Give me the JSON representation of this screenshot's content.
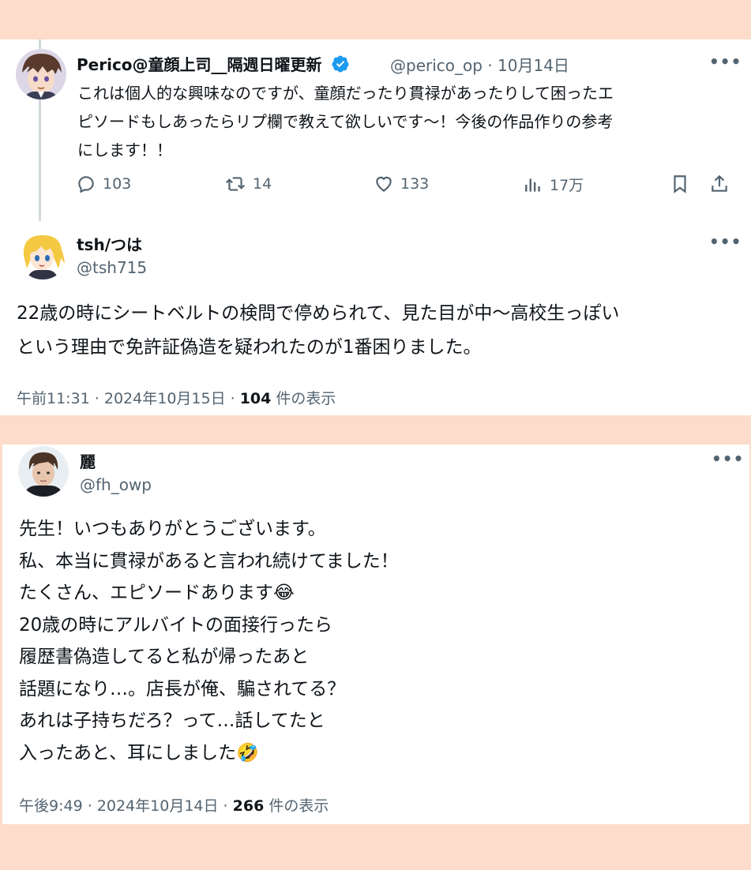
{
  "colors": {
    "background": "#fddccb",
    "card": "#ffffff",
    "text": "#0f1419",
    "muted": "#536471",
    "verified": "#1d9bf0"
  },
  "tweet1": {
    "display_name": "Perico@童顔上司__隔週日曜更新",
    "handle": "@perico_op",
    "separator": "·",
    "date": "10月14日",
    "more": "•••",
    "lines": [
      "これは個人的な興味なのですが、童顔だったり貫禄があったりして困ったエ",
      "ピソードもしあったらリプ欄で教えて欲しいです〜！今後の作品作りの参考",
      "にします！！"
    ],
    "actions": {
      "replies": "103",
      "retweets": "14",
      "likes": "133",
      "views": "17万"
    }
  },
  "tweet2": {
    "display_name": "tsh/つは",
    "handle": "@tsh715",
    "more": "•••",
    "lines": [
      "22歳の時にシートベルトの検問で停められて、見た目が中〜高校生っぽい",
      "という理由で免許証偽造を疑われたのが1番困りました。"
    ],
    "meta": {
      "datetime": "午前11:31 · 2024年10月15日 · ",
      "views_count": "104",
      "views_label": " 件の表示"
    }
  },
  "tweet3": {
    "display_name": "麗",
    "handle": "@fh_owp",
    "more": "•••",
    "lines": [
      "先生！いつもありがとうございます。",
      "私、本当に貫禄があると言われ続けてました！",
      "たくさん、エピソードあります😂",
      "20歳の時にアルバイトの面接行ったら",
      "履歴書偽造してると私が帰ったあと",
      "話題になり…。店長が俺、騙されてる？",
      "あれは子持ちだろ？って…話してたと",
      "入ったあと、耳にしました🤣"
    ],
    "meta": {
      "datetime": "午後9:49 · 2024年10月14日 · ",
      "views_count": "266",
      "views_label": " 件の表示"
    }
  }
}
